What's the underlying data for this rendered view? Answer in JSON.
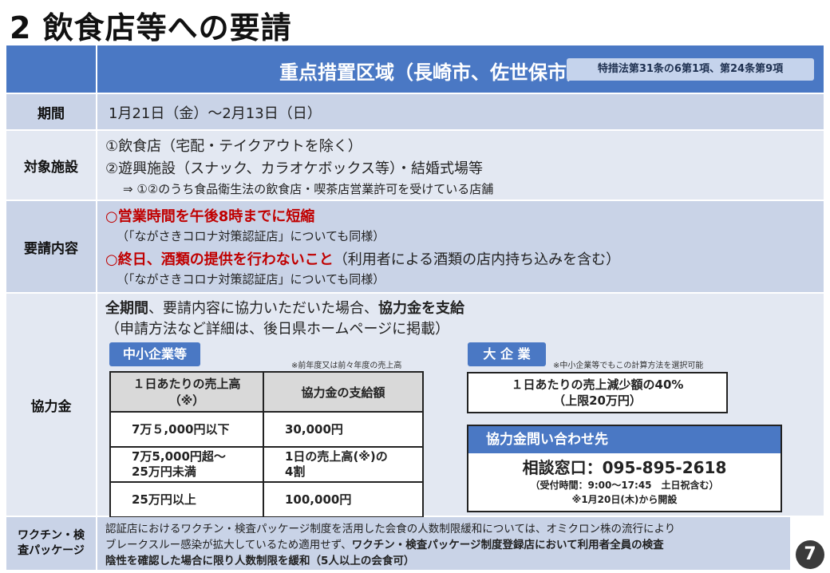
{
  "title": "2 飲食店等への要請",
  "header": {
    "region": "重点措置区域（長崎市、佐世保市）",
    "law_ref": "特措法第31条の6第1項、第24条第9項"
  },
  "period": {
    "label": "期間",
    "value": "1月21日（金）～2月13日（日）"
  },
  "facilities": {
    "label": "対象施設",
    "line1": "①飲食店（宅配・テイクアウトを除く）",
    "line2": "②遊興施設（スナック、カラオケボックス等）・結婚式場等",
    "line3": "⇒ ①②のうち食品衛生法の飲食店・喫茶店営業許可を受けている店舗"
  },
  "request": {
    "label": "要請内容",
    "item1_red": "○営業時間を午後8時までに短縮",
    "item1_note": "（「ながさきコロナ対策認証店」についても同様）",
    "item2_red": "○終日、酒類の提供を行わないこと",
    "item2_rest": "（利用者による酒類の店内持ち込みを含む）",
    "item2_note": "（「ながさきコロナ対策認証店」についても同様）"
  },
  "support": {
    "label": "協力金",
    "intro_bold1": "全期間",
    "intro_mid": "、要請内容に協力いただいた場合、",
    "intro_bold2": "協力金を支給",
    "intro_line2": "（申請方法など詳細は、後日県ホームページに掲載）",
    "sme": {
      "badge": "中小企業等",
      "note": "※前年度又は前々年度の売上高",
      "col1": "１日あたりの売上高",
      "col1_sub": "（※）",
      "col2": "協力金の支給額",
      "rows": [
        {
          "sales": "7万５,000円以下",
          "amount": "30,000円"
        },
        {
          "sales": "7万5,000円超～",
          "sales2": "25万円未満",
          "amount": "1日の売上高(※)の",
          "amount2": "4割"
        },
        {
          "sales": "25万円以上",
          "amount": "100,000円"
        }
      ]
    },
    "large": {
      "badge": "大 企 業",
      "note": "※中小企業等でもこの計算方法を選択可能",
      "line1": "１日あたりの売上減少額の40%",
      "line2": "（上限20万円）"
    },
    "inquiry": {
      "title": "協力金問い合わせ先",
      "phone": "相談窓口：095-895-2618",
      "hours": "（受付時間：9:00～17:45　土日祝含む）",
      "open": "※1月20日(木)から開設"
    }
  },
  "vaccine": {
    "label1": "ワクチン・検",
    "label2": "査パッケージ",
    "line1": "認証店におけるワクチン・検査パッケージ制度を活用した会食の人数制限緩和については、オミクロン株の流行により",
    "line2_normal": "ブレークスルー感染が拡大しているため適用せず、",
    "line2_bold": "ワクチン・検査パッケージ制度登録店において利用者全員の検査",
    "line3_bold": "陰性を確認した場合に限り人数制限を緩和（5人以上の会食可）"
  },
  "page_number": "7"
}
